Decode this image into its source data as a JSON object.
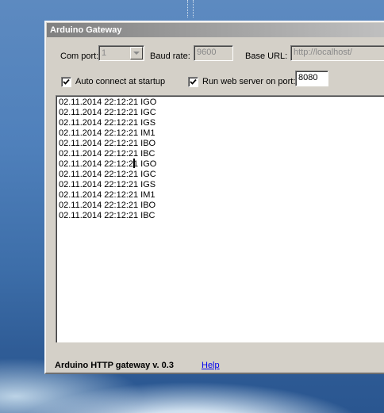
{
  "window": {
    "title": "Arduino Gateway"
  },
  "settings": {
    "com_port_label": "Com port:",
    "com_port_value": "1",
    "baud_rate_label": "Baud rate:",
    "baud_rate_value": "9600",
    "base_url_label": "Base URL:",
    "base_url_value": "http://localhost/",
    "auto_connect_label": "Auto connect at startup",
    "auto_connect_checked": true,
    "web_server_label": "Run web server on port:",
    "web_server_checked": true,
    "web_server_port": "8080"
  },
  "log": {
    "lines": [
      "02.11.2014 22:12:21 IGO",
      "02.11.2014 22:12:21 IGC",
      "02.11.2014 22:12:21 IGS",
      "02.11.2014 22:12:21 IM1",
      "02.11.2014 22:12:21 IBO",
      "02.11.2014 22:12:21 IBC",
      "02.11.2014 22:12:21 IGO",
      "02.11.2014 22:12:21 IGC",
      "02.11.2014 22:12:21 IGS",
      "02.11.2014 22:12:21 IM1",
      "02.11.2014 22:12:21 IBO",
      "02.11.2014 22:12:21 IBC"
    ]
  },
  "footer": {
    "status_text": "Arduino HTTP gateway v. 0.3",
    "help_link": "Help"
  },
  "colors": {
    "window_face": "#d4d0c8",
    "titlebar_inactive": "#808080",
    "link": "#0000ee",
    "desktop": "#4f80bb"
  }
}
